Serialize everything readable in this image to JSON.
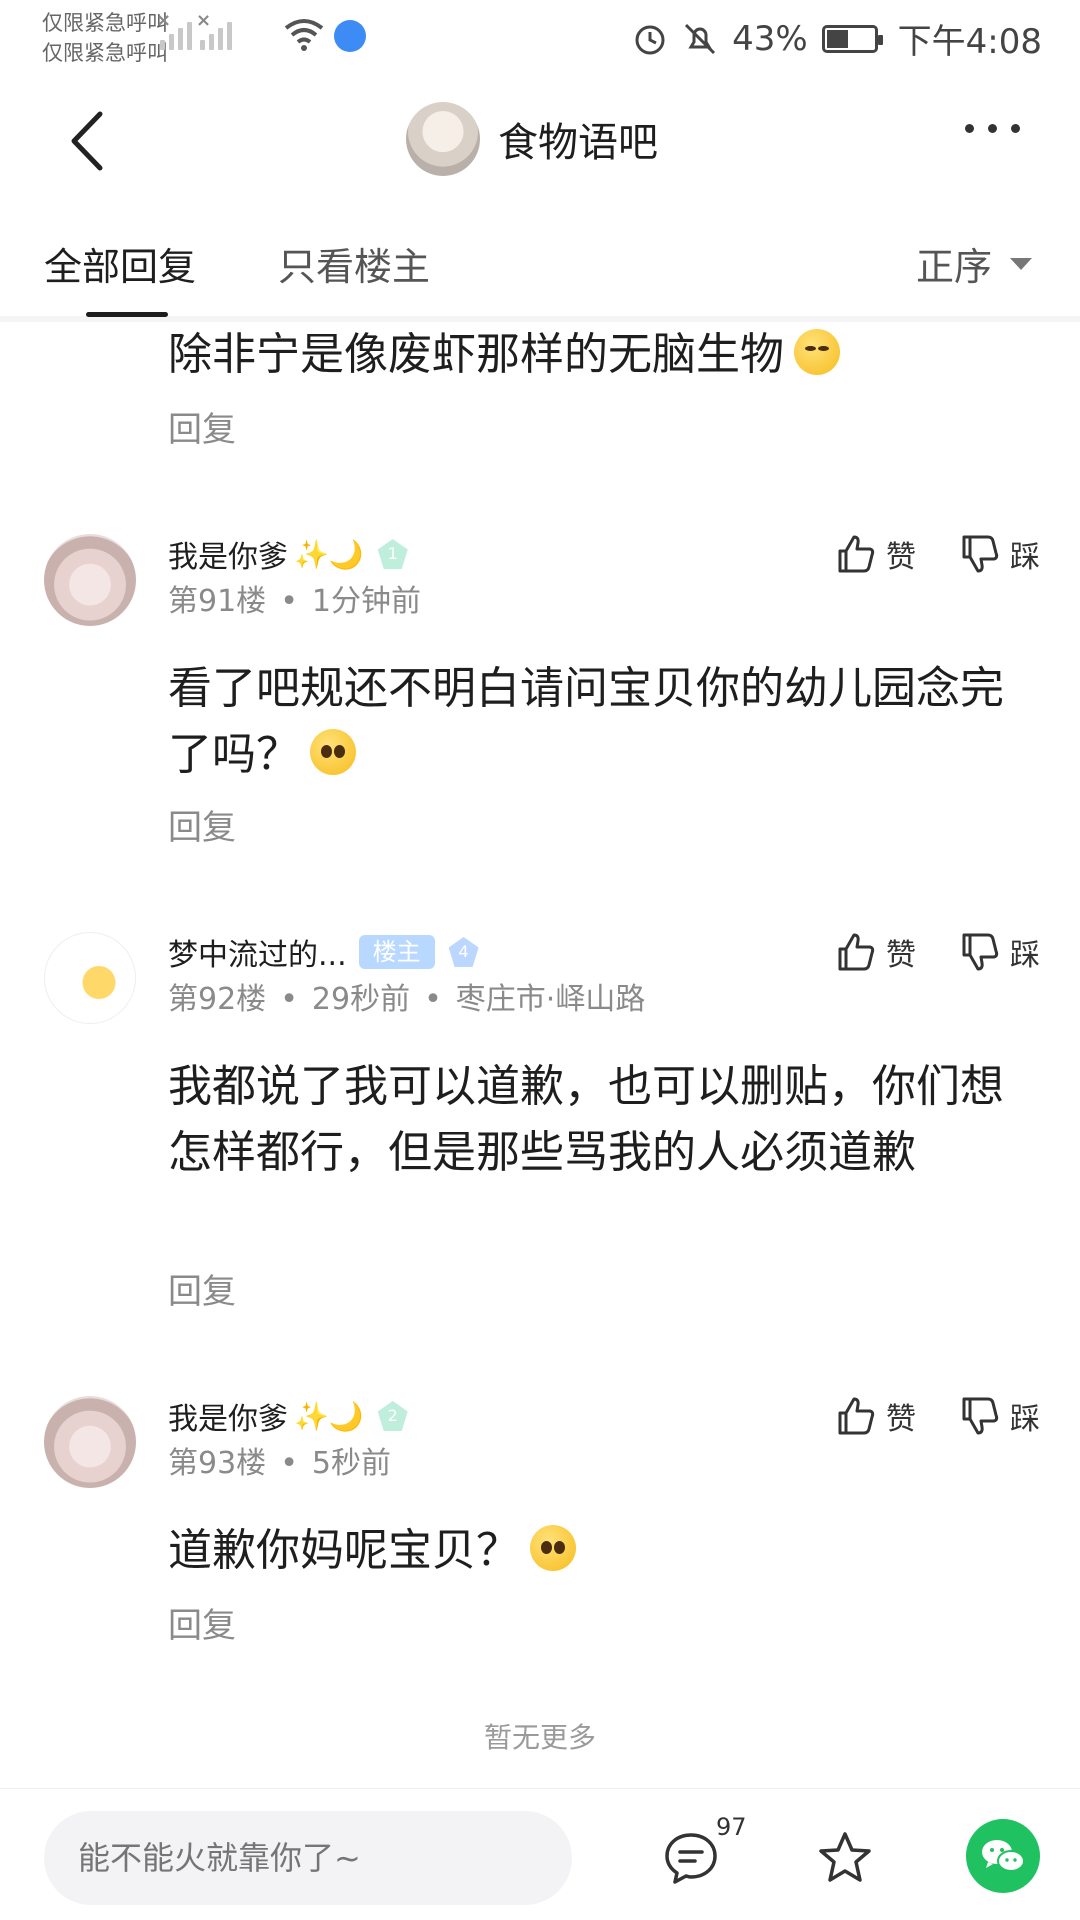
{
  "status_bar": {
    "carrier_line1": "仅限紧急呼叫",
    "carrier_line2": "仅限紧急呼叫",
    "battery": "43%",
    "time": "下午4:08"
  },
  "header": {
    "title": "食物语吧"
  },
  "tabs": {
    "all": "全部回复",
    "op_only": "只看楼主",
    "sort": "正序"
  },
  "partial_post": {
    "text": "除非宁是像废虾那样的无脑生物",
    "reply": "回复"
  },
  "posts": [
    {
      "username": "我是你爹",
      "level": "1",
      "floor": "第91楼",
      "time": "1分钟前",
      "text": "看了吧规还不明白请问宝贝你的幼儿园念完了吗？",
      "like": "赞",
      "dislike": "踩",
      "reply": "回复"
    },
    {
      "username": "梦中流过的...",
      "badge": "楼主",
      "level": "4",
      "floor": "第92楼",
      "time": "29秒前",
      "location": "枣庄市·峄山路",
      "text": "我都说了我可以道歉，也可以删贴，你们想怎样都行，但是那些骂我的人必须道歉",
      "like": "赞",
      "dislike": "踩",
      "reply": "回复"
    },
    {
      "username": "我是你爹",
      "level": "2",
      "floor": "第93楼",
      "time": "5秒前",
      "text": "道歉你妈呢宝贝？",
      "like": "赞",
      "dislike": "踩",
      "reply": "回复"
    }
  ],
  "footer": {
    "no_more": "暂无更多",
    "input_placeholder": "能不能火就靠你了~",
    "comment_count": "97"
  },
  "icons": {
    "back": "back-arrow-icon",
    "more": "more-dots-icon",
    "like": "thumbs-up-icon",
    "dislike": "thumbs-down-icon",
    "comment": "comment-bubble-icon",
    "favorite": "star-icon",
    "share": "wechat-icon"
  },
  "colors": {
    "op_badge": "#b9d8ff",
    "wechat_green": "#20c160",
    "meta_gray": "#8a8a8a"
  }
}
